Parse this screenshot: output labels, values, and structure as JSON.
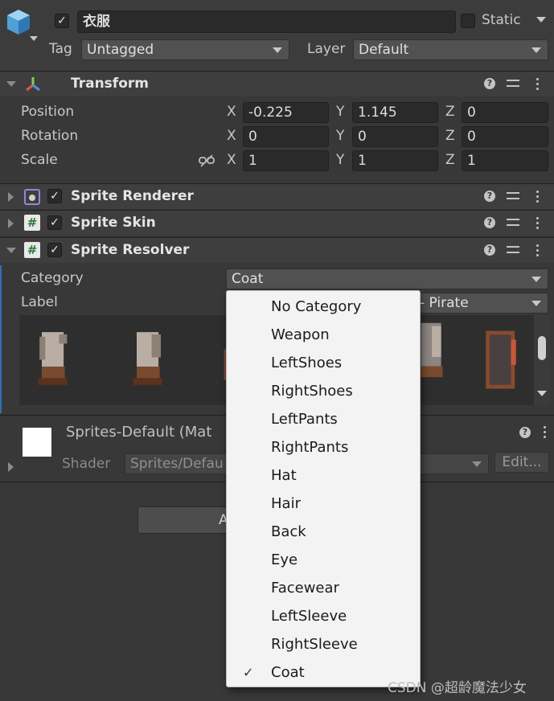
{
  "gameobject": {
    "name": "衣服",
    "active": true,
    "static_label": "Static",
    "tag_label": "Tag",
    "tag_value": "Untagged",
    "layer_label": "Layer",
    "layer_value": "Default"
  },
  "transform": {
    "title": "Transform",
    "position_label": "Position",
    "rotation_label": "Rotation",
    "scale_label": "Scale",
    "x": "X",
    "y": "Y",
    "z": "Z",
    "position": {
      "x": "-0.225",
      "y": "1.145",
      "z": "0"
    },
    "rotation": {
      "x": "0",
      "y": "0",
      "z": "0"
    },
    "scale": {
      "x": "1",
      "y": "1",
      "z": "1"
    }
  },
  "components": {
    "sprite_renderer": "Sprite Renderer",
    "sprite_skin": "Sprite Skin",
    "sprite_resolver": "Sprite Resolver"
  },
  "resolver": {
    "category_label": "Category",
    "category_value": "Coat",
    "label_label": "Label",
    "label_value": "- Pirate"
  },
  "material": {
    "name": "Sprites-Default (Mat",
    "shader_label": "Shader",
    "shader_value": "Sprites/Defau",
    "edit_label": "Edit..."
  },
  "add_component_partial": "A",
  "dropdown": {
    "items": [
      "No Category",
      "Weapon",
      "LeftShoes",
      "RightShoes",
      "LeftPants",
      "RightPants",
      "Hat",
      "Hair",
      "Back",
      "Eye",
      "Facewear",
      "LeftSleeve",
      "RightSleeve",
      "Coat"
    ],
    "selected": "Coat",
    "check_mark": "✓"
  },
  "watermark": "CSDN @超龄魔法少女",
  "colors": {
    "background": "#383838",
    "header": "#3e3e3e",
    "field": "#2a2a2a",
    "menu": "#f3f3f3",
    "accent": "#2f6eb5"
  }
}
